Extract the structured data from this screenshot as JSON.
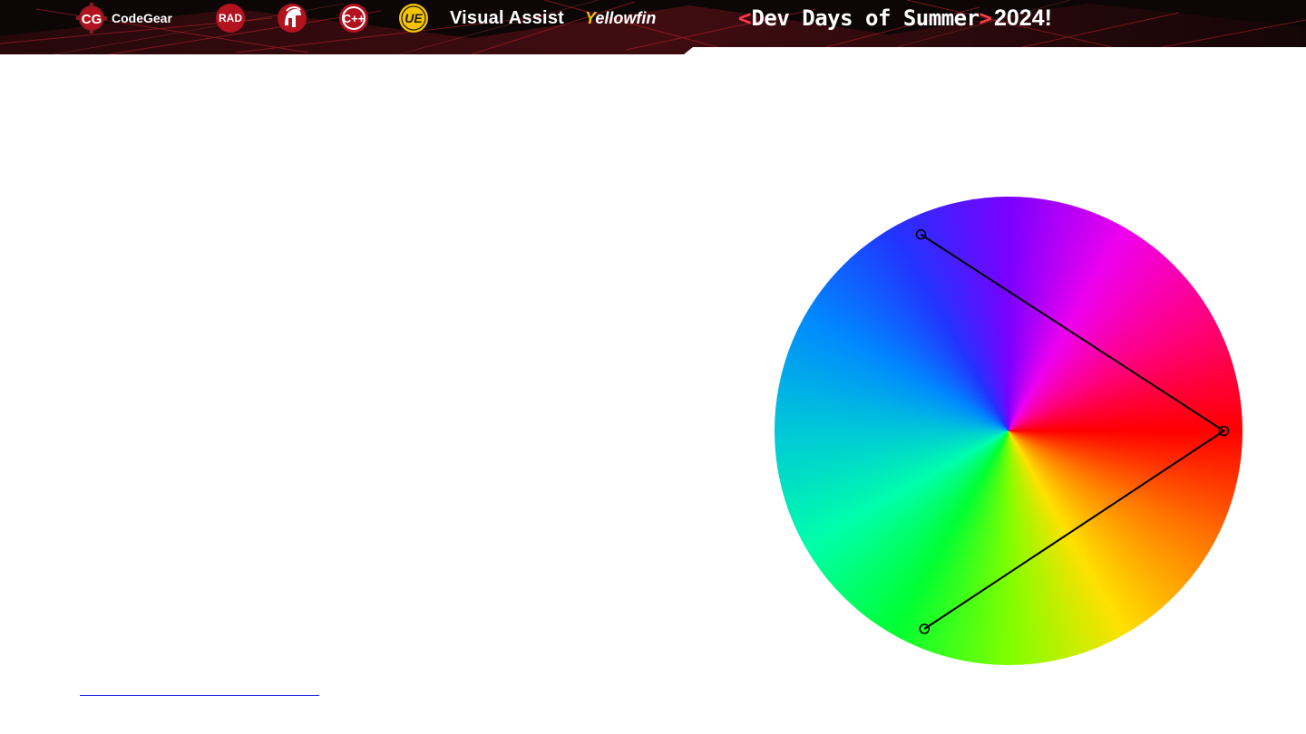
{
  "banner": {
    "logos": {
      "codegear_mark": "CG",
      "codegear_label": "CodeGear",
      "rad_mark": "RAD",
      "cpp_mark": "C++",
      "ue_mark": "UE",
      "visual_assist_label": "Visual Assist",
      "yellowfin_first_letter": "Y",
      "yellowfin_rest": "ellowfin"
    },
    "event": {
      "open_bracket": "<",
      "name": "Dev Days of Summer",
      "close_bracket": ">",
      "year": "2024!"
    },
    "colors": {
      "background": "#0b0506",
      "accent": "#ff3a4a",
      "logo_red": "#b3121f",
      "ue_yellow": "#f5c400"
    }
  },
  "color_wheel": {
    "harmony": "triadic",
    "handle_hues_deg": [
      0,
      113,
      246
    ],
    "handle_saturation": 0.92
  },
  "colors": {
    "page_background": "#ffffff",
    "link_rule": "#2a2ae0"
  }
}
